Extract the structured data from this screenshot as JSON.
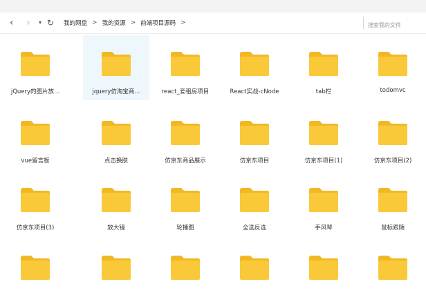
{
  "navigation": {
    "back_icon": "chevron-left-icon",
    "forward_icon": "chevron-right-icon",
    "history_icon": "caret-down-icon",
    "refresh_icon": "refresh-icon",
    "breadcrumb": [
      "我的网盘",
      "我的资源",
      "前端项目源码"
    ],
    "separator": ">"
  },
  "search": {
    "placeholder": "搜索我的文件"
  },
  "folders": [
    {
      "name": "jQuery的图片放..."
    },
    {
      "name": "jquery仿淘宝商..."
    },
    {
      "name": "react_爱租房项目"
    },
    {
      "name": "React实战-cNode"
    },
    {
      "name": "tab栏"
    },
    {
      "name": "todomvc"
    },
    {
      "name": "vue留言板"
    },
    {
      "name": "点击换肤"
    },
    {
      "name": "仿京东商品展示"
    },
    {
      "name": "仿京东项目"
    },
    {
      "name": "仿京东项目(1)"
    },
    {
      "name": "仿京东项目(2)"
    },
    {
      "name": "仿京东项目(3)"
    },
    {
      "name": "放大镜"
    },
    {
      "name": "轮播图"
    },
    {
      "name": "全选反选"
    },
    {
      "name": "手风琴"
    },
    {
      "name": "鼠标跟随"
    },
    {
      "name": ""
    },
    {
      "name": ""
    },
    {
      "name": ""
    },
    {
      "name": ""
    },
    {
      "name": ""
    },
    {
      "name": ""
    }
  ],
  "selected_index": 1,
  "colors": {
    "folder_body": "#f9c93a",
    "folder_tab": "#f2b824",
    "selection": "#eef7fc"
  }
}
